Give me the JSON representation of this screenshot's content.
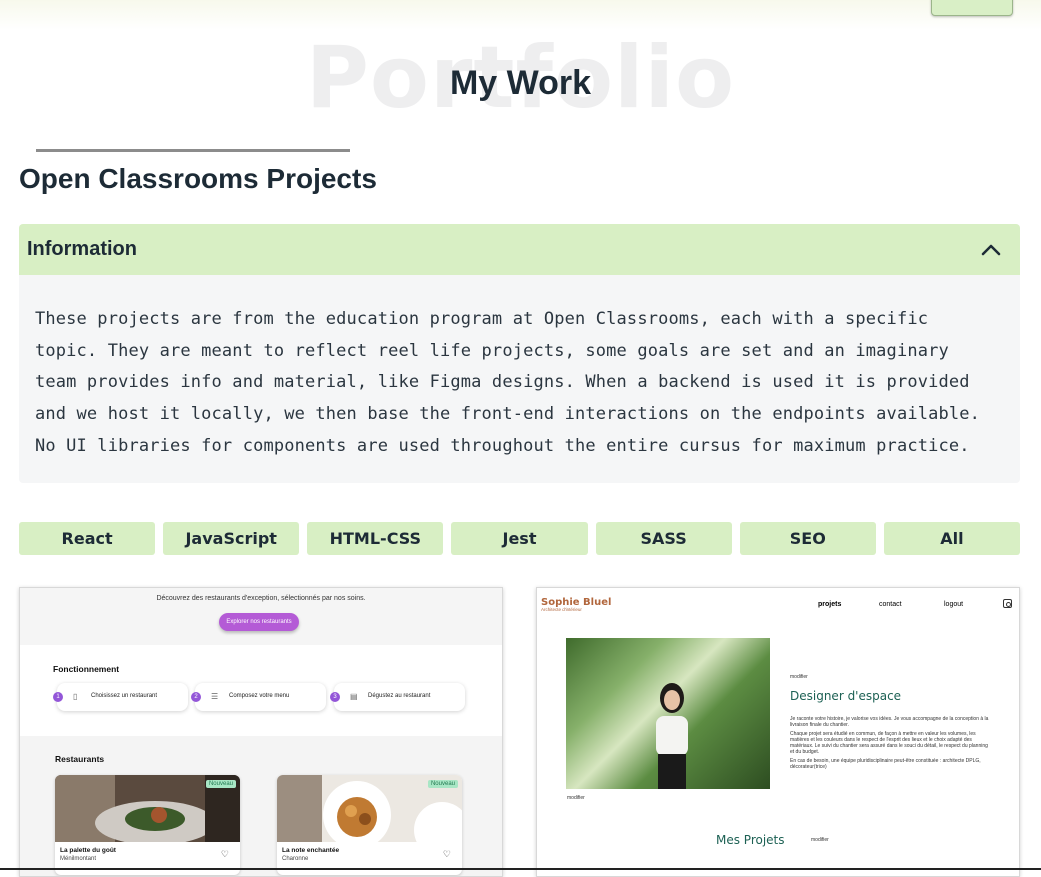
{
  "header": {
    "watermark": "Portfolio",
    "title": "My Work",
    "section_title": "Open Classrooms Projects"
  },
  "accordion": {
    "label": "Information",
    "expanded": true,
    "text": "These projects are from the education program at Open Classrooms, each with a specific\ntopic. They are meant to reflect reel life projects, some goals are set and an imaginary\nteam provides info and material, like Figma designs. When a backend is used it is provided\nand we host it locally, we then base the front-end interactions on the endpoints available.\nNo UI libraries for components are used throughout the entire cursus for maximum practice."
  },
  "filters": [
    "React",
    "JavaScript",
    "HTML-CSS",
    "Jest",
    "SASS",
    "SEO",
    "All"
  ],
  "colors": {
    "accent": "#d8efc4",
    "text": "#1d2b36",
    "sophie_brand": "#b1663c",
    "sophie_green": "#1d6154",
    "restaurant_purple": "#b45bd6"
  },
  "projects": {
    "restaurant": {
      "tagline": "Découvrez des restaurants d'exception, sélectionnés par nos soins.",
      "cta": "Explorer nos restaurants",
      "how_title": "Fonctionnement",
      "steps": [
        {
          "num": "1",
          "icon": "phone-icon",
          "glyph": "▯",
          "label": "Choisissez un restaurant"
        },
        {
          "num": "2",
          "icon": "list-icon",
          "glyph": "☰",
          "label": "Composez votre menu"
        },
        {
          "num": "3",
          "icon": "store-icon",
          "glyph": "▤",
          "label": "Dégustez au restaurant"
        }
      ],
      "restaurants_title": "Restaurants",
      "items": [
        {
          "name": "La palette du goût",
          "location": "Ménilmontant",
          "badge": "Nouveau"
        },
        {
          "name": "La note enchantée",
          "location": "Charonne",
          "badge": "Nouveau"
        }
      ]
    },
    "sophie": {
      "logo": "Sophie Bluel",
      "subtitle": "Architecte d'intérieur",
      "nav": [
        "projets",
        "contact",
        "logout"
      ],
      "modify": "modifier",
      "headline": "Designer d'espace",
      "paragraphs": [
        "Je raconte votre histoire, je valorise vos idées. Je vous accompagne de la conception à la livraison finale du chantier.",
        "Chaque projet sera étudié en commun, de façon à mettre en valeur les volumes, les matières et les couleurs dans le respect de l'esprit des lieux et le choix adapté des matériaux. Le suivi du chantier sera assuré dans le souci du détail, le respect du planning et du budget.",
        "En cas de besoin, une équipe pluridisciplinaire peut-être constituée : architecte DPLG, décorateur(trice)"
      ],
      "projects_title": "Mes Projets"
    }
  }
}
